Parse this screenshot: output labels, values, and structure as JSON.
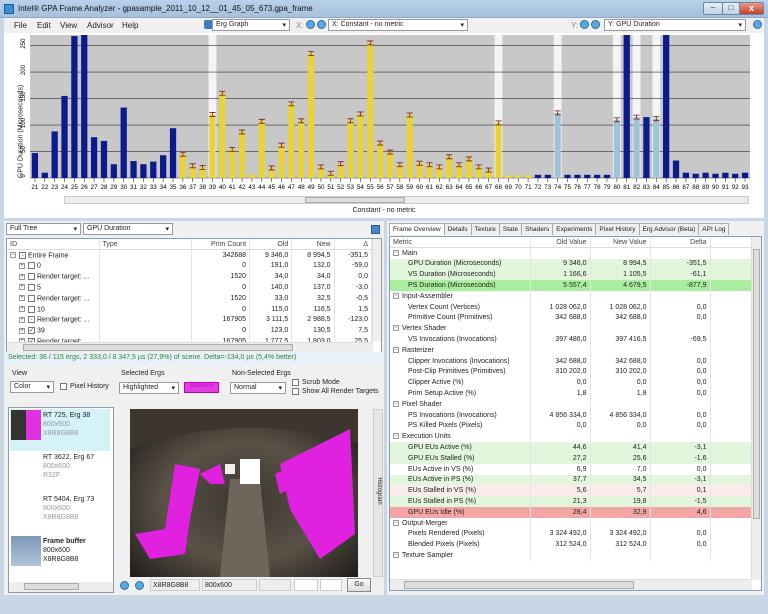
{
  "window": {
    "title": "Intel® GPA Frame Analyzer - gpasample_2011_10_12__01_45_05_673.gpa_frame",
    "min": "–",
    "max": "□",
    "close": "x"
  },
  "menu": [
    "File",
    "Edit",
    "View",
    "Advisor",
    "Help"
  ],
  "toolbar": {
    "graph_mode": "Erg Graph",
    "x_label": "X:",
    "x_metric": "X: Constant - no metric",
    "y_label": "Y:",
    "y_metric": "Y: GPU Duration"
  },
  "chart_data": {
    "type": "bar",
    "title": "",
    "xlabel": "Constant - no metric",
    "ylabel": "GPU Duration (Microseconds)",
    "ylim": [
      0,
      270
    ],
    "yticks": [
      0,
      50,
      100,
      150,
      200,
      250
    ],
    "grid": true,
    "categories": [
      21,
      22,
      23,
      24,
      25,
      26,
      27,
      28,
      29,
      30,
      31,
      32,
      33,
      34,
      35,
      36,
      37,
      38,
      39,
      40,
      41,
      42,
      43,
      44,
      45,
      46,
      47,
      48,
      49,
      50,
      51,
      52,
      53,
      54,
      55,
      56,
      57,
      58,
      59,
      60,
      61,
      62,
      63,
      64,
      65,
      66,
      67,
      68,
      69,
      70,
      71,
      72,
      73,
      74,
      75,
      76,
      77,
      78,
      79,
      80,
      81,
      82,
      83,
      84,
      85,
      86,
      87,
      88,
      89,
      90,
      91,
      92,
      93
    ],
    "values": [
      47,
      10,
      88,
      155,
      268,
      270,
      77,
      70,
      26,
      133,
      32,
      26,
      31,
      43,
      94,
      45,
      23,
      20,
      120,
      160,
      54,
      87,
      7,
      107,
      19,
      62,
      140,
      108,
      235,
      21,
      9,
      27,
      108,
      121,
      255,
      66,
      49,
      25,
      119,
      28,
      25,
      21,
      40,
      25,
      36,
      21,
      15,
      104,
      5,
      5,
      5,
      6,
      6,
      123,
      6,
      6,
      6,
      6,
      6,
      110,
      270,
      115,
      115,
      112,
      270,
      33,
      10,
      8,
      10,
      8,
      10,
      8,
      10
    ],
    "series_colors": {
      "unselected": "#0c1a8c",
      "selected": "#e8d33a",
      "highlighted": "#9ec3d6"
    },
    "selected_categories": [
      36,
      37,
      38,
      39,
      40,
      41,
      42,
      43,
      44,
      45,
      46,
      47,
      48,
      49,
      50,
      51,
      52,
      53,
      54,
      55,
      56,
      57,
      58,
      59,
      60,
      61,
      62,
      63,
      64,
      65,
      66,
      67,
      68,
      69,
      70,
      71
    ],
    "highlighted_categories": [
      74,
      80,
      82,
      84
    ],
    "marked_columns": [
      39,
      68,
      74,
      80,
      82,
      84
    ]
  },
  "tree": {
    "mode": "Full Tree",
    "metric": "GPU Duration",
    "columns": [
      "ID",
      "Type",
      "Prim Count",
      "Old",
      "New",
      "Δ"
    ],
    "rows": [
      {
        "id": "Entire Frame",
        "prim": "342688",
        "old": "9 346,0",
        "new": "8 994,5",
        "delta": "-351,5",
        "check": "partial",
        "root": true
      },
      {
        "id": "0",
        "prim": "0",
        "old": "191,0",
        "new": "132,0",
        "delta": "-59,0",
        "check": ""
      },
      {
        "id": "Render target: ...",
        "prim": "1520",
        "old": "34,0",
        "new": "34,0",
        "delta": "0,0",
        "check": ""
      },
      {
        "id": "5",
        "prim": "0",
        "old": "140,0",
        "new": "137,0",
        "delta": "-3,0",
        "check": ""
      },
      {
        "id": "Render target: ...",
        "prim": "1520",
        "old": "33,0",
        "new": "32,5",
        "delta": "-0,5",
        "check": ""
      },
      {
        "id": "10",
        "prim": "0",
        "old": "115,0",
        "new": "116,5",
        "delta": "1,5",
        "check": ""
      },
      {
        "id": "Render target: ...",
        "prim": "167905",
        "old": "3 111,5",
        "new": "2 988,5",
        "delta": "-123,0",
        "check": "partial"
      },
      {
        "id": "39",
        "prim": "0",
        "old": "123,0",
        "new": "130,5",
        "delta": "7,5",
        "check": "checked"
      },
      {
        "id": "Render target: ...",
        "prim": "167905",
        "old": "1 777,5",
        "new": "1 803,0",
        "delta": "25,5",
        "check": "checked"
      }
    ],
    "status": "Selected: 36 / 115 ergs, 2 333,0 / 8 347,5 µs (27,9%) of scene.  Delta=-134,0 µs (5,4% better)"
  },
  "viewer": {
    "view_label": "View",
    "view_value": "Color",
    "pixel_history": "Pixel History",
    "selected_label": "Selected Ergs",
    "selected_value": "Highlighted",
    "selection_swatch": "selection",
    "nonselected_label": "Non-Selected Ergs",
    "nonselected_value": "Normal",
    "scrub": "Scrub Mode",
    "show_all": "Show All Render Targets",
    "histogram": "Histogram",
    "thumbs": [
      {
        "name": "RT 725, Erg 38",
        "size": "800x600",
        "format": "X8R8G8B8"
      },
      {
        "name": "RT 3622, Erg 67",
        "size": "800x600",
        "format": "R32F"
      },
      {
        "name": "RT 5404, Erg 73",
        "size": "800x600",
        "format": "X8R8G8B8"
      },
      {
        "name": "Frame buffer",
        "size": "800x600",
        "format": "X8R8G8B8"
      }
    ],
    "format": "X8R8G8B8",
    "resolution": "800x600",
    "go": "Go"
  },
  "tabs": [
    "Frame Overview",
    "Details",
    "Texture",
    "State",
    "Shaders",
    "Experiments",
    "Pixel History",
    "Erg Advisor (Beta)",
    "API Log"
  ],
  "metrics": {
    "columns": [
      "Metric",
      "Old Value",
      "New Value",
      "Delta"
    ],
    "colors": {
      "good": "#e2f6dc",
      "better": "#a9ee9f",
      "worse": "#fbeceb",
      "bad": "#f4a6a4"
    },
    "rows": [
      {
        "g": "Main"
      },
      {
        "m": "GPU Duration (Microseconds)",
        "o": "9 346,0",
        "n": "8 994,5",
        "d": "-351,5",
        "c": "good"
      },
      {
        "m": "VS Duration (Microseconds)",
        "o": "1 166,6",
        "n": "1 105,5",
        "d": "-61,1",
        "c": "good"
      },
      {
        "m": "PS Duration (Microseconds)",
        "o": "5 557,4",
        "n": "4 679,5",
        "d": "-877,9",
        "c": "better"
      },
      {
        "g": "Input-Assembler"
      },
      {
        "m": "Vertex Count (Vertices)",
        "o": "1 028 062,0",
        "n": "1 028 062,0",
        "d": "0,0"
      },
      {
        "m": "Primitive Count (Primitives)",
        "o": "342 688,0",
        "n": "342 688,0",
        "d": "0,0"
      },
      {
        "g": "Vertex Shader"
      },
      {
        "m": "VS Invocations (Invocations)",
        "o": "397 486,0",
        "n": "397 416,5",
        "d": "-69,5"
      },
      {
        "g": "Rasterizer"
      },
      {
        "m": "Clipper Invocations (Invocations)",
        "o": "342 688,0",
        "n": "342 688,0",
        "d": "0,0"
      },
      {
        "m": "Post-Clip Primitives (Primitives)",
        "o": "310 202,0",
        "n": "310 202,0",
        "d": "0,0"
      },
      {
        "m": "Clipper Active (%)",
        "o": "0,0",
        "n": "0,0",
        "d": "0,0"
      },
      {
        "m": "Prim Setup Active (%)",
        "o": "1,8",
        "n": "1,8",
        "d": "0,0"
      },
      {
        "g": "Pixel Shader"
      },
      {
        "m": "PS Invocations (Invocations)",
        "o": "4 856 334,0",
        "n": "4 856 334,0",
        "d": "0,0"
      },
      {
        "m": "PS Killed Pixels (Pixels)",
        "o": "0,0",
        "n": "0,0",
        "d": "0,0"
      },
      {
        "g": "Execution Units"
      },
      {
        "m": "GPU EUs Active (%)",
        "o": "44,6",
        "n": "41,4",
        "d": "-3,1",
        "c": "good"
      },
      {
        "m": "GPU EUs Stalled (%)",
        "o": "27,2",
        "n": "25,6",
        "d": "-1,6",
        "c": "good"
      },
      {
        "m": "EUs Active in VS (%)",
        "o": "6,9",
        "n": "7,0",
        "d": "0,0"
      },
      {
        "m": "EUs Active in PS (%)",
        "o": "37,7",
        "n": "34,5",
        "d": "-3,1",
        "c": "good"
      },
      {
        "m": "EUs Stalled in VS (%)",
        "o": "5,6",
        "n": "5,7",
        "d": "0,1",
        "c": "worse"
      },
      {
        "m": "EUs Stalled in PS (%)",
        "o": "21,3",
        "n": "19,8",
        "d": "-1,5",
        "c": "good"
      },
      {
        "m": "GPU EUs Idle (%)",
        "o": "28,4",
        "n": "32,9",
        "d": "4,6",
        "c": "bad"
      },
      {
        "g": "Output-Merger"
      },
      {
        "m": "Pixels Rendered (Pixels)",
        "o": "3 324 492,0",
        "n": "3 324 492,0",
        "d": "0,0"
      },
      {
        "m": "Blended Pixels (Pixels)",
        "o": "312 524,0",
        "n": "312 524,0",
        "d": "0,0"
      },
      {
        "g": "Texture Sampler"
      }
    ]
  }
}
